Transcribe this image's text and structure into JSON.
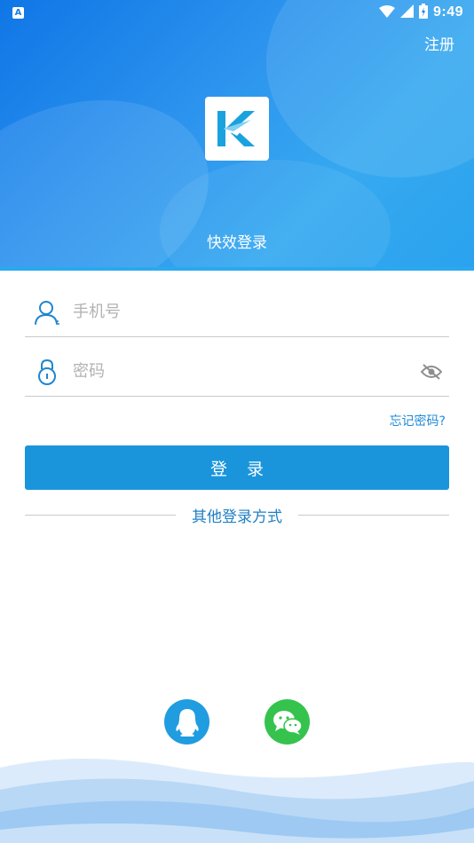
{
  "status_bar": {
    "app_icon_letter": "A",
    "time": "9:49",
    "icons": [
      "wifi-icon",
      "signal-icon",
      "battery-icon"
    ]
  },
  "header": {
    "register_label": "注册",
    "logo_icon": "k-plane-logo-icon",
    "title": "快效登录"
  },
  "form": {
    "phone": {
      "placeholder": "手机号",
      "value": "",
      "icon": "user-icon"
    },
    "password": {
      "placeholder": "密码",
      "value": "",
      "icon": "lock-icon",
      "toggle_icon": "eye-off-icon"
    },
    "forgot_label": "忘记密码?",
    "login_label": "登录"
  },
  "other_login": {
    "label": "其他登录方式",
    "options": [
      {
        "name": "qq",
        "icon": "qq-penguin-icon",
        "color": "#1f9de0"
      },
      {
        "name": "wechat",
        "icon": "wechat-icon",
        "color": "#35c34e"
      }
    ]
  },
  "colors": {
    "primary": "#1a95dc",
    "header_gradient_start": "#0f76e6",
    "header_gradient_end": "#2aa2ee",
    "link": "#1f8ad8",
    "input_placeholder": "#b2b2b2"
  }
}
